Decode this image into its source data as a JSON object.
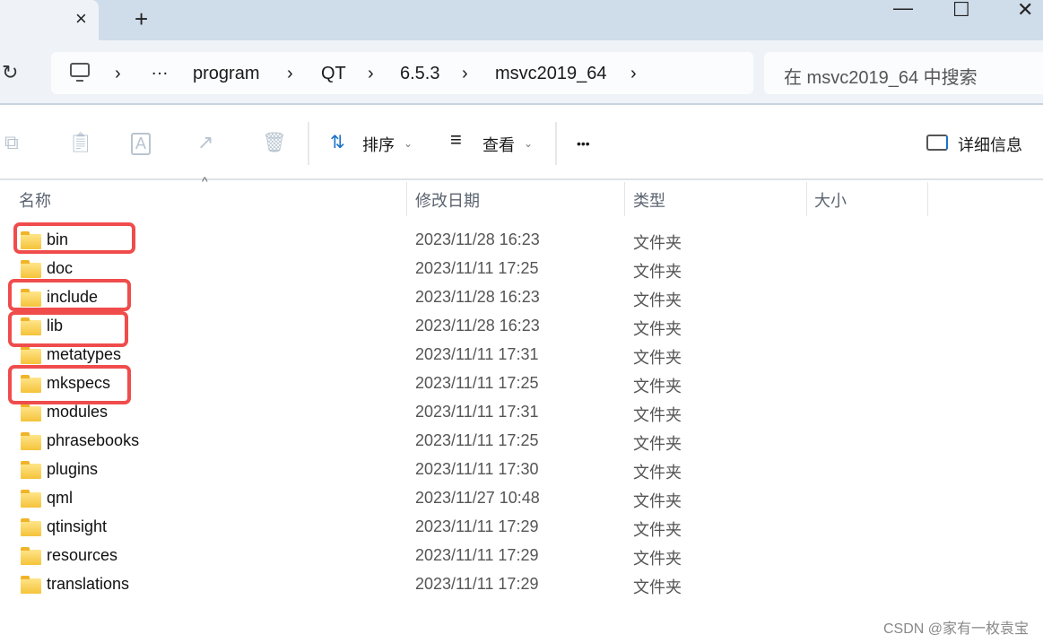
{
  "window": {
    "new_tab": "+",
    "close_tab": "×",
    "minimize": "—",
    "maximize": "☐",
    "close": "✕"
  },
  "address": {
    "crumbs": [
      "…",
      "program",
      "QT",
      "6.5.3",
      "msvc2019_64"
    ],
    "separator": "›"
  },
  "search": {
    "placeholder": "在 msvc2019_64 中搜索"
  },
  "toolbar": {
    "sort": "排序",
    "view": "查看",
    "more": "•••",
    "details": "详细信息"
  },
  "columns": {
    "name": "名称",
    "modified": "修改日期",
    "type": "类型",
    "size": "大小"
  },
  "files": [
    {
      "name": "bin",
      "modified": "2023/11/28 16:23",
      "type": "文件夹",
      "highlighted": true
    },
    {
      "name": "doc",
      "modified": "2023/11/11 17:25",
      "type": "文件夹",
      "highlighted": false
    },
    {
      "name": "include",
      "modified": "2023/11/28 16:23",
      "type": "文件夹",
      "highlighted": true
    },
    {
      "name": "lib",
      "modified": "2023/11/28 16:23",
      "type": "文件夹",
      "highlighted": true
    },
    {
      "name": "metatypes",
      "modified": "2023/11/11 17:31",
      "type": "文件夹",
      "highlighted": false
    },
    {
      "name": "mkspecs",
      "modified": "2023/11/11 17:25",
      "type": "文件夹",
      "highlighted": true
    },
    {
      "name": "modules",
      "modified": "2023/11/11 17:31",
      "type": "文件夹",
      "highlighted": false
    },
    {
      "name": "phrasebooks",
      "modified": "2023/11/11 17:25",
      "type": "文件夹",
      "highlighted": false
    },
    {
      "name": "plugins",
      "modified": "2023/11/11 17:30",
      "type": "文件夹",
      "highlighted": false
    },
    {
      "name": "qml",
      "modified": "2023/11/27 10:48",
      "type": "文件夹",
      "highlighted": false
    },
    {
      "name": "qtinsight",
      "modified": "2023/11/11 17:29",
      "type": "文件夹",
      "highlighted": false
    },
    {
      "name": "resources",
      "modified": "2023/11/11 17:29",
      "type": "文件夹",
      "highlighted": false
    },
    {
      "name": "translations",
      "modified": "2023/11/11 17:29",
      "type": "文件夹",
      "highlighted": false
    }
  ],
  "watermark": "CSDN @家有一枚袁宝",
  "colors": {
    "highlight": "#f04c4c",
    "tabbar": "#cfdcea",
    "folder": "#f5c33b"
  }
}
